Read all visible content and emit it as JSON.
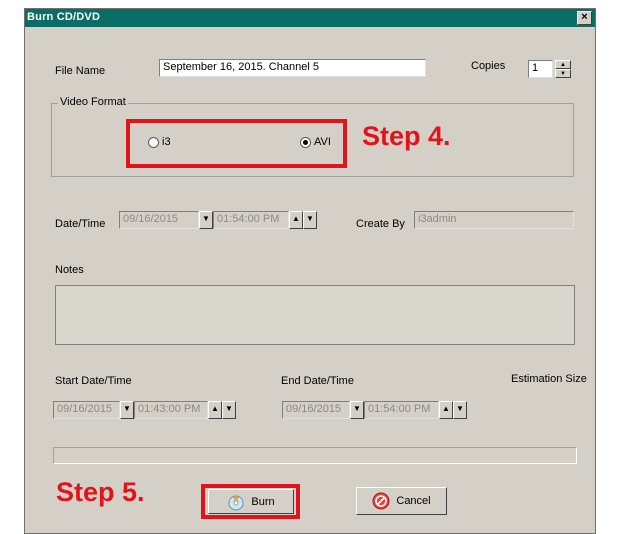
{
  "window": {
    "title": "Burn CD/DVD",
    "close_glyph": "×"
  },
  "file": {
    "label": "File Name",
    "value": "September 16, 2015. Channel 5"
  },
  "copies": {
    "label": "Copies",
    "value": "1"
  },
  "video_format": {
    "legend": "Video Format",
    "options": [
      {
        "label": "i3",
        "selected": false
      },
      {
        "label": "AVI",
        "selected": true
      }
    ]
  },
  "date_time": {
    "label": "Date/Time",
    "date": "09/16/2015",
    "time": "01:54:00 PM"
  },
  "create_by": {
    "label": "Create By",
    "value": "i3admin"
  },
  "notes": {
    "label": "Notes",
    "value": ""
  },
  "start": {
    "label": "Start Date/Time",
    "date": "09/16/2015",
    "time": "01:43:00 PM"
  },
  "end": {
    "label": "End Date/Time",
    "date": "09/16/2015",
    "time": "01:54:00 PM"
  },
  "estimation": {
    "label": "Estimation Size"
  },
  "buttons": {
    "burn": "Burn",
    "cancel": "Cancel"
  },
  "annotations": {
    "step4": "Step 4.",
    "step5": "Step 5."
  },
  "glyphs": {
    "down": "▼",
    "up": "▲",
    "spin_up": "▲",
    "spin_down": "▼"
  },
  "colors": {
    "titlebar": "#0a6d66",
    "dialog": "#d4d0c8",
    "annotation": "#e0141a"
  }
}
